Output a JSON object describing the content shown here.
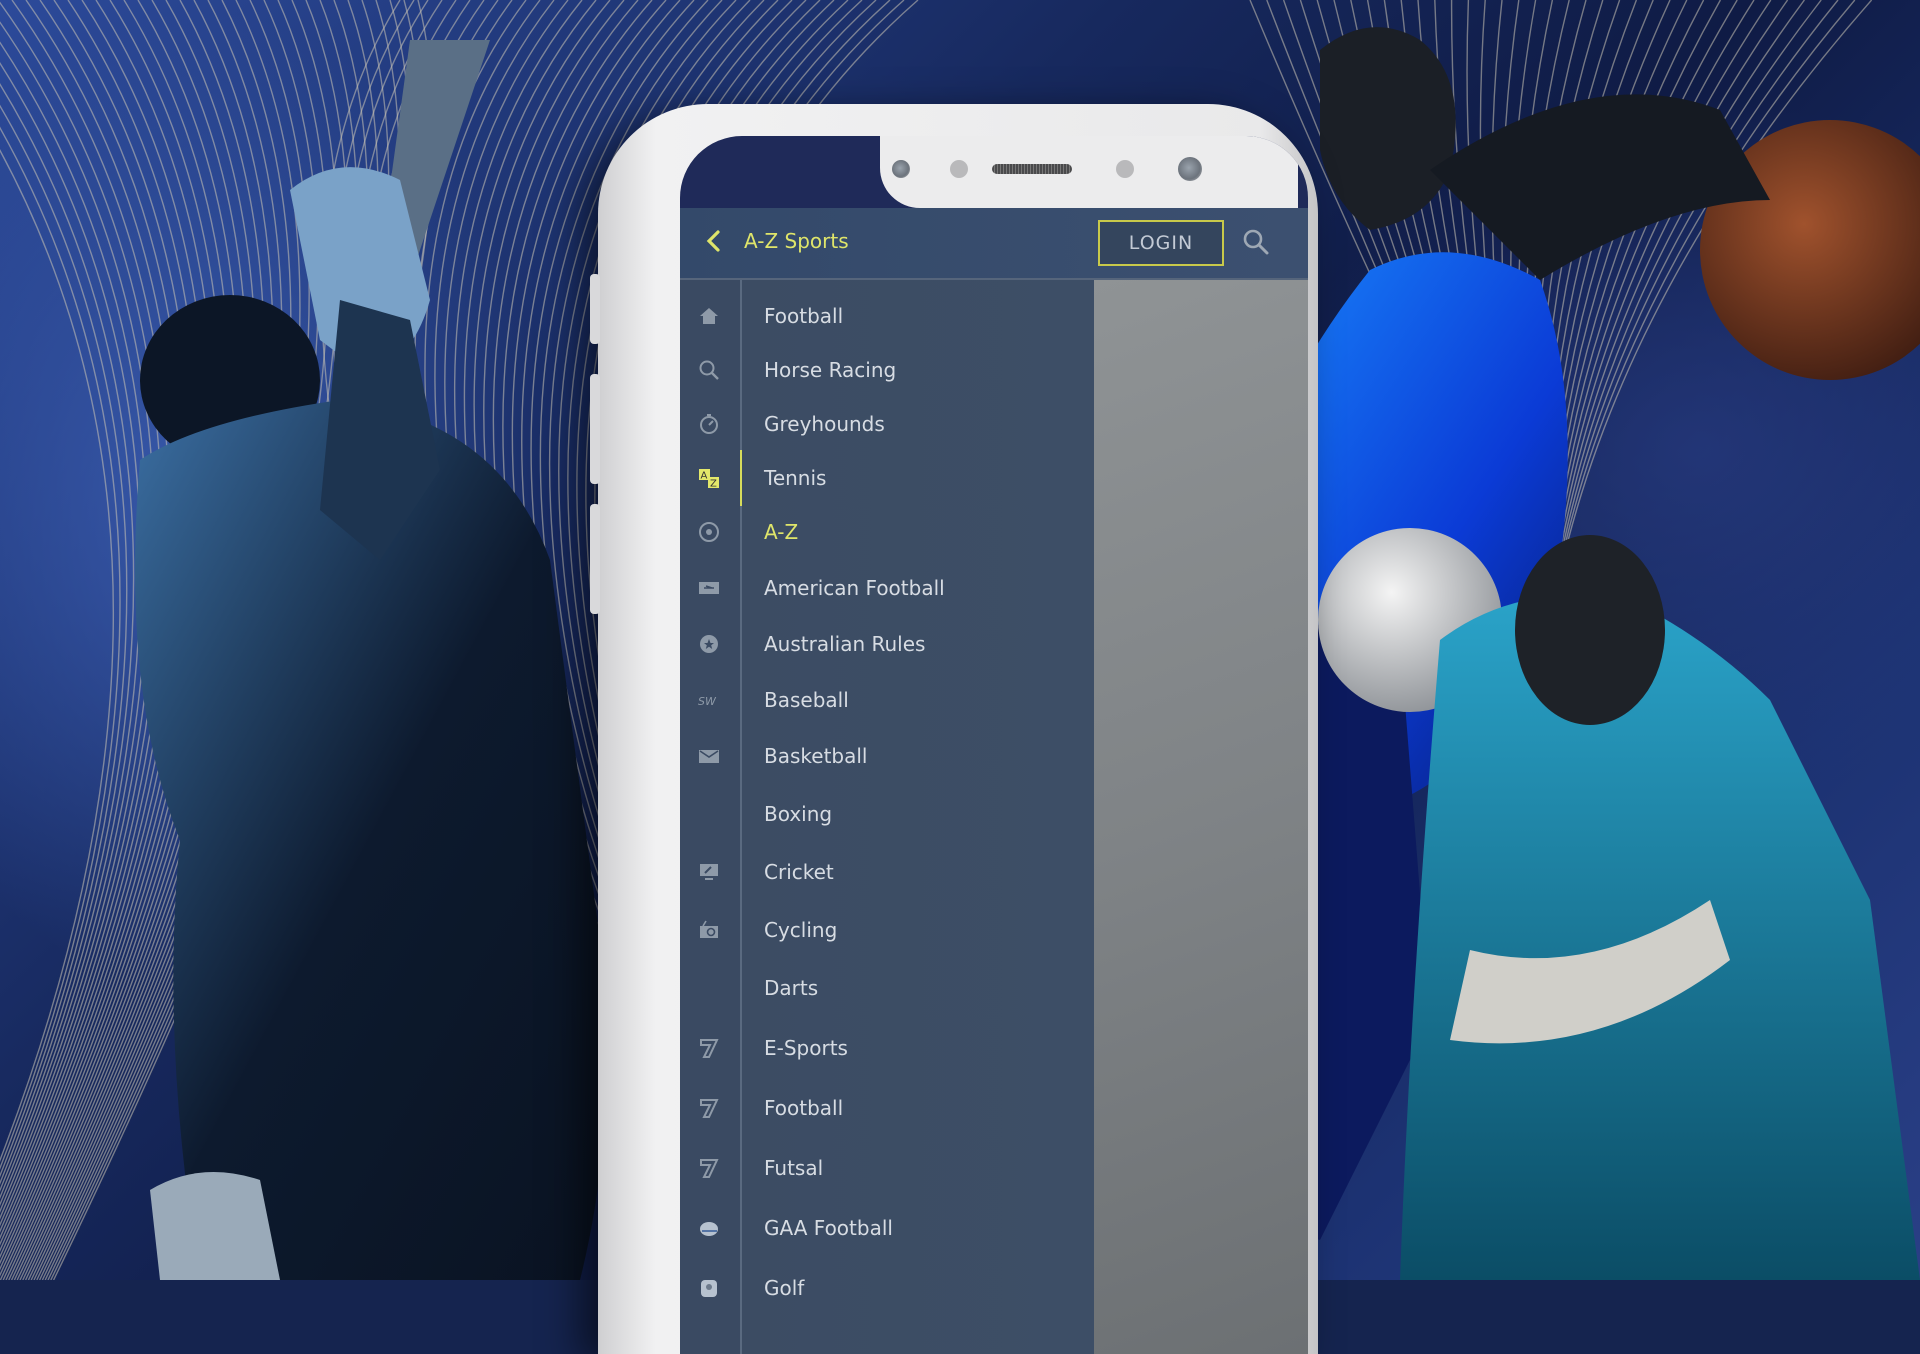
{
  "header": {
    "back_icon": "chevron-left-icon",
    "title": "A-Z Sports",
    "login_label": "LOGIN",
    "search_icon": "search-icon"
  },
  "colors": {
    "accent": "#dfe56a",
    "menu_bg": "#3c4c63",
    "header_bg": "#36496a",
    "text": "#d7dce3",
    "login_border": "#c8c94a"
  },
  "sidebar_icons": [
    {
      "icon": "home-icon"
    },
    {
      "icon": "search-icon"
    },
    {
      "icon": "stopwatch-icon"
    },
    {
      "icon": "az-icon",
      "active": true
    },
    {
      "icon": "soccer-ball-icon"
    },
    {
      "icon": "ticket-icon"
    },
    {
      "icon": "badge-star-icon"
    },
    {
      "icon": "signature-icon"
    },
    {
      "icon": "envelope-icon"
    },
    {
      "icon": ""
    },
    {
      "icon": "monitor-icon"
    },
    {
      "icon": "radio-icon"
    },
    {
      "icon": ""
    },
    {
      "icon": "seven-icon"
    },
    {
      "icon": "seven-icon"
    },
    {
      "icon": "seven-icon"
    },
    {
      "icon": "helmet-icon"
    },
    {
      "icon": "golf-icon"
    }
  ],
  "menu": {
    "items": [
      {
        "label": "Football"
      },
      {
        "label": "Horse Racing"
      },
      {
        "label": "Greyhounds"
      },
      {
        "label": "Tennis"
      },
      {
        "label": "A-Z",
        "active": true
      },
      {
        "label": "American Football"
      },
      {
        "label": "Australian Rules"
      },
      {
        "label": "Baseball"
      },
      {
        "label": "Basketball"
      },
      {
        "label": "Boxing"
      },
      {
        "label": "Cricket"
      },
      {
        "label": "Cycling"
      },
      {
        "label": "Darts"
      },
      {
        "label": "E-Sports"
      },
      {
        "label": "Football"
      },
      {
        "label": "Futsal"
      },
      {
        "label": "GAA Football"
      },
      {
        "label": "Golf"
      }
    ]
  }
}
